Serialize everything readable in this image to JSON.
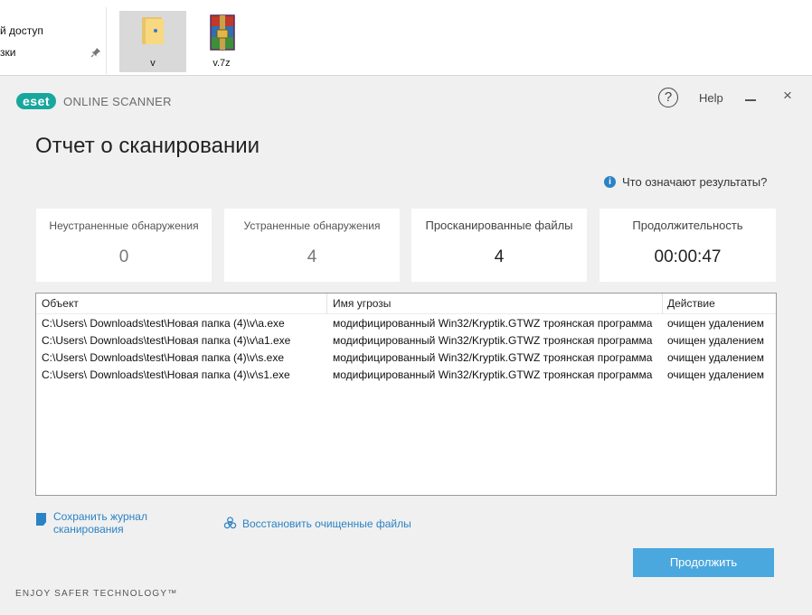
{
  "explorer": {
    "nav_items": [
      {
        "label": "й доступ"
      },
      {
        "label": "зки"
      }
    ],
    "files": [
      {
        "name": "v",
        "icon": "folder-icon",
        "selected": true
      },
      {
        "name": "v.7z",
        "icon": "winrar-archive-icon",
        "selected": false
      }
    ]
  },
  "window": {
    "logo_badge": "eset",
    "logo_text": "ONLINE SCANNER",
    "help_symbol": "?",
    "help_label": "Help",
    "close_symbol": "×",
    "title": "Отчет о сканировании",
    "results_link": "Что означают результаты?"
  },
  "stats": [
    {
      "caption": "Неустраненные обнаружения",
      "value": "0"
    },
    {
      "caption": "Устраненные обнаружения",
      "value": "4"
    },
    {
      "caption": "Просканированные файлы",
      "value": "4"
    },
    {
      "caption": "Продолжительность",
      "value": "00:00:47"
    }
  ],
  "table": {
    "columns": [
      "Объект",
      "Имя угрозы",
      "Действие"
    ],
    "rows": [
      {
        "object": "C:\\Users\\ Downloads\\test\\Новая папка (4)\\v\\a.exe",
        "threat": "модифицированный Win32/Kryptik.GTWZ троянская программа",
        "action": "очищен удалением"
      },
      {
        "object": "C:\\Users\\ Downloads\\test\\Новая папка (4)\\v\\a1.exe",
        "threat": "модифицированный Win32/Kryptik.GTWZ троянская программа",
        "action": "очищен удалением"
      },
      {
        "object": "C:\\Users\\ Downloads\\test\\Новая папка (4)\\v\\s.exe",
        "threat": "модифицированный Win32/Kryptik.GTWZ троянская программа",
        "action": "очищен удалением"
      },
      {
        "object": "C:\\Users\\ Downloads\\test\\Новая папка (4)\\v\\s1.exe",
        "threat": "модифицированный Win32/Kryptik.GTWZ троянская программа",
        "action": "очищен удалением"
      }
    ]
  },
  "links": {
    "save_log": [
      "Сохранить журнал",
      "сканирования"
    ],
    "restore": "Восстановить очищенные файлы"
  },
  "continue_label": "Продолжить",
  "footer": "ENJOY SAFER TECHNOLOGY™",
  "colors": {
    "accent": "#4aa8de",
    "link": "#2b83c4",
    "brand": "#17a79d"
  }
}
